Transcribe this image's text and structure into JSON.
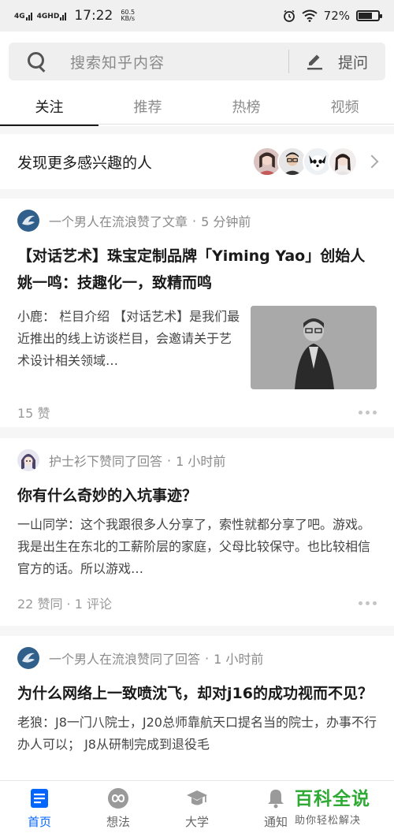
{
  "status_bar": {
    "network_1": "4G",
    "network_2": "4GHD",
    "time": "17:22",
    "speed_value": "60.5",
    "speed_unit": "KB/s",
    "battery_text": "72%",
    "battery_level": 0.72
  },
  "search": {
    "placeholder": "搜索知乎内容",
    "ask_label": "提问"
  },
  "tabs": [
    {
      "label": "关注",
      "active": true
    },
    {
      "label": "推荐",
      "active": false
    },
    {
      "label": "热榜",
      "active": false
    },
    {
      "label": "视频",
      "active": false
    }
  ],
  "discover": {
    "title": "发现更多感兴趣的人"
  },
  "feed": [
    {
      "actor": "一个男人在流浪赞了文章",
      "time": "5 分钟前",
      "title": "【对话艺术】珠宝定制品牌「Yiming Yao」创始人姚一鸣：技趣化一，致精而鸣",
      "excerpt": "小鹿： 栏目介绍 【对话艺术】是我们最近推出的线上访谈栏目，会邀请关于艺术设计相关领域…",
      "stats": "15 赞"
    },
    {
      "actor": "护士衫下赞同了回答",
      "time": "1 小时前",
      "title": "你有什么奇妙的入坑事迹？",
      "excerpt": "一山同学：这个我跟很多人分享了，索性就都分享了吧。游戏。 我是出生在东北的工薪阶层的家庭，父母比较保守。也比较相信官方的话。所以游戏…",
      "stats": "22 赞同 · 1 评论"
    },
    {
      "actor": "一个男人在流浪赞同了回答",
      "time": "1 小时前",
      "title": "为什么网络上一致喷沈飞，却对j16的成功视而不见？",
      "excerpt": "老狼：J8一门八院士，J20总师靠航天口提名当的院士，办事不行办人可以； J8从研制完成到退役毛"
    }
  ],
  "bottom_nav": [
    {
      "label": "首页",
      "icon": "home-doc-icon",
      "active": true
    },
    {
      "label": "想法",
      "icon": "infinity-icon",
      "active": false
    },
    {
      "label": "大学",
      "icon": "graduation-cap-icon",
      "active": false
    },
    {
      "label": "通知",
      "icon": "bell-icon",
      "active": false
    }
  ],
  "watermark": {
    "title": "百科全说",
    "subtitle": "助你轻松解决"
  },
  "colors": {
    "accent": "#0066ff",
    "watermark_green": "#2eaa35"
  }
}
